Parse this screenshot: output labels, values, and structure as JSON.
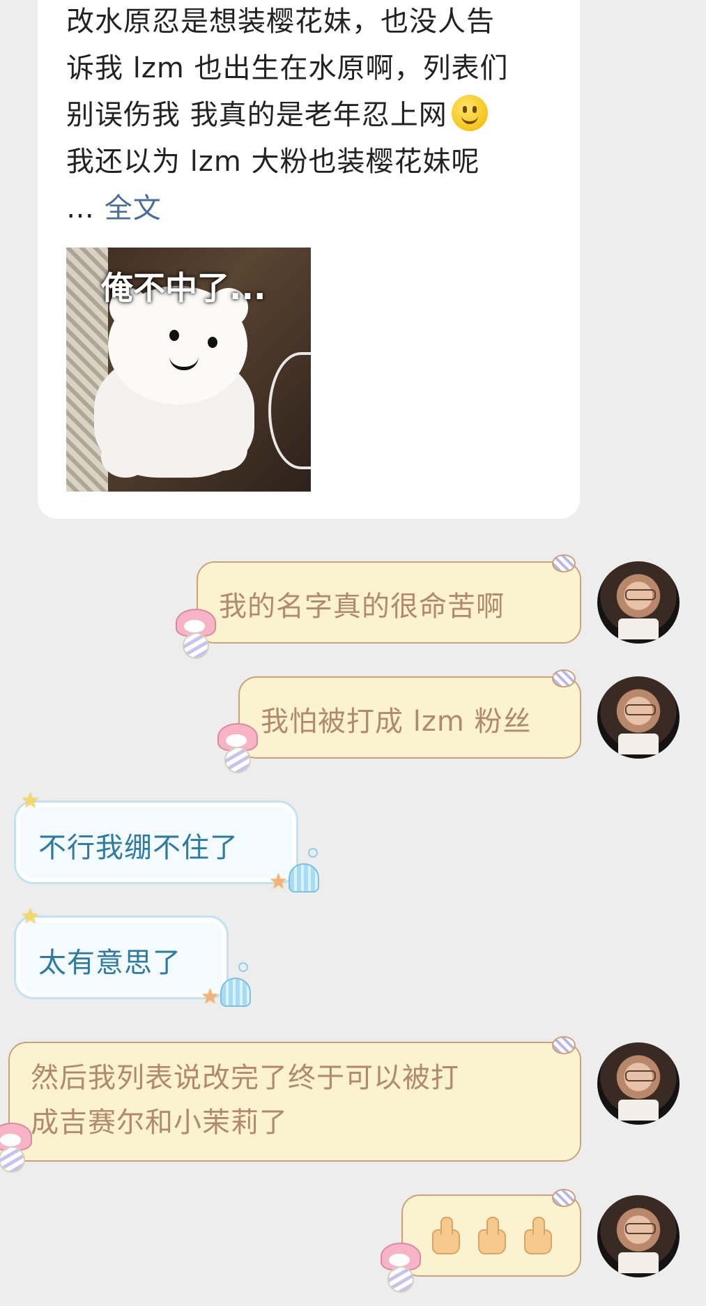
{
  "post": {
    "lines": [
      "改水原忍是想装樱花妹，也没人告",
      "诉我 lzm 也出生在水原啊，列表们",
      "别误伤我 我真的是老年忍上网",
      "我还以为 lzm 大粉也装樱花妹呢"
    ],
    "ellipsis": "…",
    "full_text_link": "全文",
    "image_caption": "俺不中了..."
  },
  "messages": [
    {
      "side": "right",
      "text": "我的名字真的很命苦啊"
    },
    {
      "side": "right",
      "text": "我怕被打成 lzm 粉丝"
    },
    {
      "side": "left",
      "text": "不行我绷不住了"
    },
    {
      "side": "left",
      "text": "太有意思了"
    },
    {
      "side": "right",
      "lines": [
        "然后我列表说改完了终于可以被打",
        "成吉赛尔和小茉莉了"
      ]
    },
    {
      "side": "right",
      "emoji": "thumbs-up",
      "count": 3
    }
  ]
}
